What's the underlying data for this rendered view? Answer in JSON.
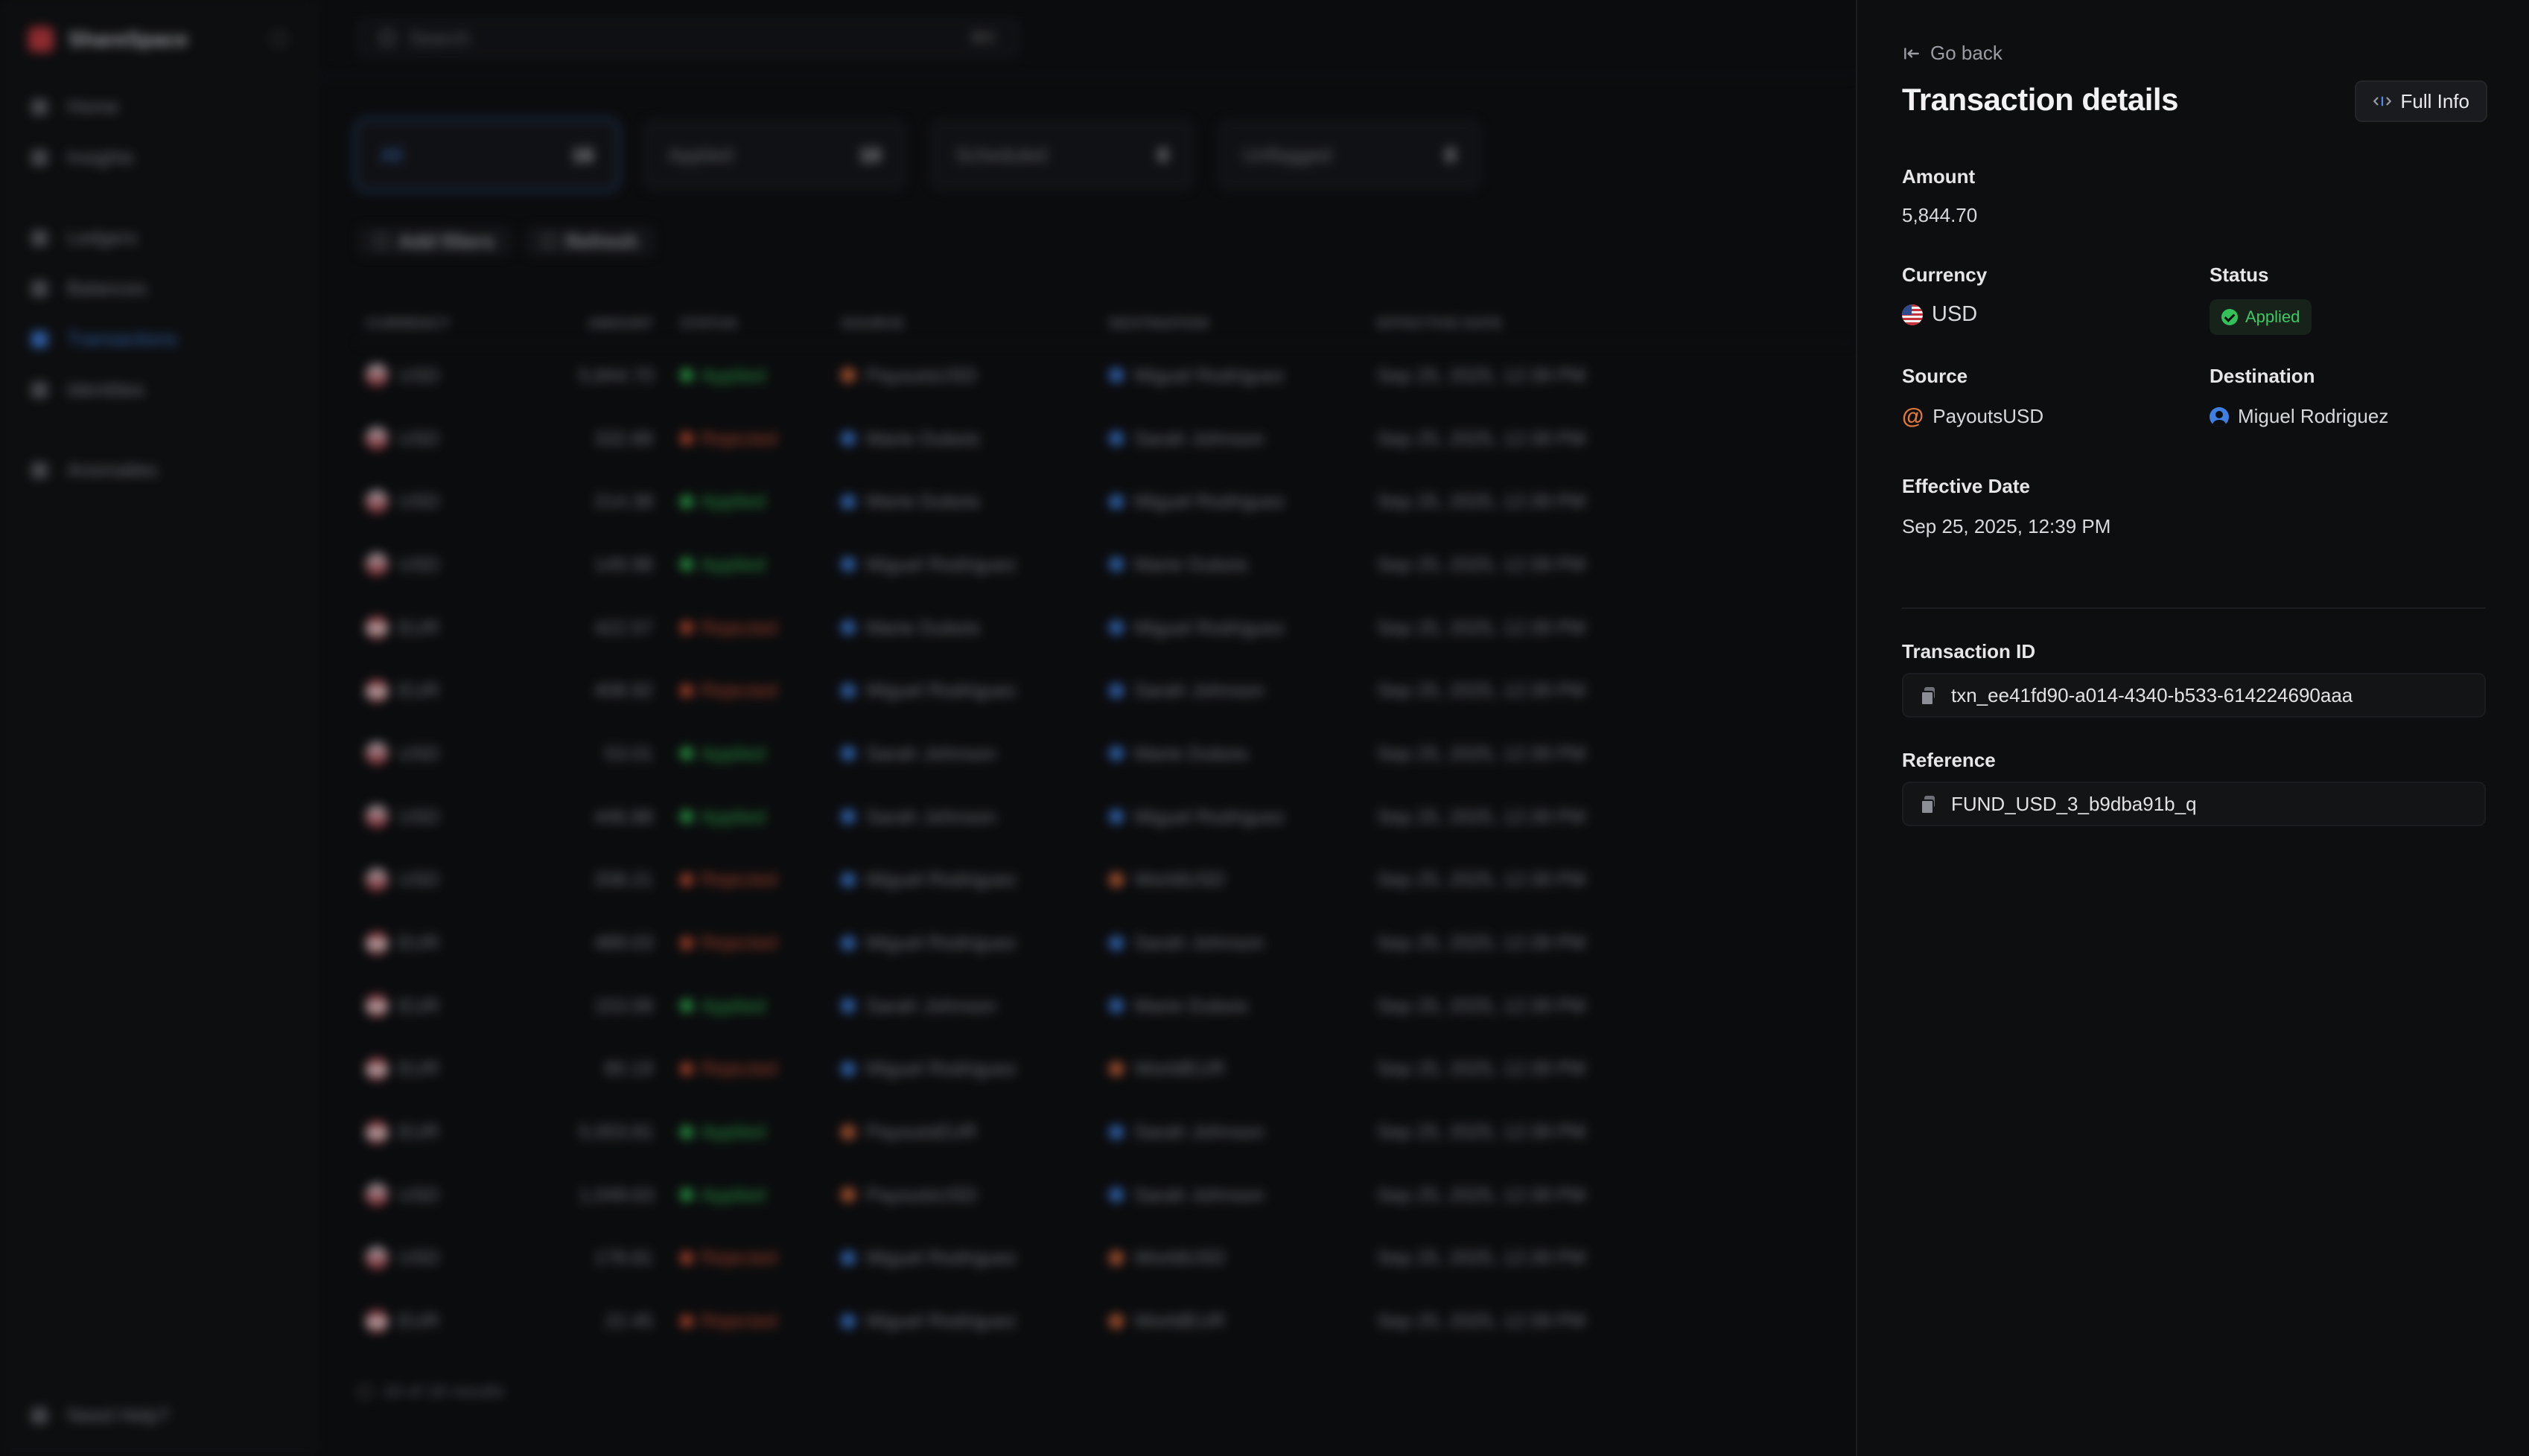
{
  "app": {
    "brand_name": "ShareSpace",
    "nav": [
      "Home",
      "Insights",
      "Ledgers",
      "Balances",
      "Transactions",
      "Identities",
      "Anomalies"
    ],
    "need_help": "Need Help?",
    "search_placeholder": "Search",
    "search_kbd": "⌘K",
    "tabs": [
      {
        "label": "All",
        "count": "16"
      },
      {
        "label": "Applied",
        "count": "10"
      },
      {
        "label": "Scheduled",
        "count": "0"
      },
      {
        "label": "Unflagged",
        "count": "0"
      }
    ],
    "filters": [
      "Add filters",
      "Refresh"
    ],
    "columns": [
      "CURRENCY",
      "AMOUNT",
      "STATUS",
      "SOURCE",
      "DESTINATION",
      "EFFECTIVE DATE"
    ],
    "rows": [
      {
        "currency": "USD",
        "amount": "5,844.70",
        "status": "Applied",
        "source": "PayoutsUSD",
        "destination": "Miguel Rodriguez",
        "date": "Sep 25, 2025, 12:39 PM"
      },
      {
        "currency": "USD",
        "amount": "332.89",
        "status": "Rejected",
        "source": "Marie Dubois",
        "destination": "Sarah Johnson",
        "date": "Sep 25, 2025, 12:39 PM"
      },
      {
        "currency": "USD",
        "amount": "214.38",
        "status": "Applied",
        "source": "Marie Dubois",
        "destination": "Miguel Rodriguez",
        "date": "Sep 25, 2025, 12:39 PM"
      },
      {
        "currency": "USD",
        "amount": "149.98",
        "status": "Applied",
        "source": "Miguel Rodriguez",
        "destination": "Marie Dubois",
        "date": "Sep 25, 2025, 12:39 PM"
      },
      {
        "currency": "EUR",
        "amount": "422.57",
        "status": "Rejected",
        "source": "Marie Dubois",
        "destination": "Miguel Rodriguez",
        "date": "Sep 25, 2025, 12:39 PM"
      },
      {
        "currency": "EUR",
        "amount": "408.92",
        "status": "Rejected",
        "source": "Miguel Rodriguez",
        "destination": "Sarah Johnson",
        "date": "Sep 25, 2025, 12:39 PM"
      },
      {
        "currency": "USD",
        "amount": "53.01",
        "status": "Applied",
        "source": "Sarah Johnson",
        "destination": "Marie Dubois",
        "date": "Sep 25, 2025, 12:39 PM"
      },
      {
        "currency": "USD",
        "amount": "446.88",
        "status": "Applied",
        "source": "Sarah Johnson",
        "destination": "Miguel Rodriguez",
        "date": "Sep 25, 2025, 12:39 PM"
      },
      {
        "currency": "USD",
        "amount": "208.21",
        "status": "Rejected",
        "source": "Miguel Rodriguez",
        "destination": "WorldUSD",
        "date": "Sep 25, 2025, 12:39 PM"
      },
      {
        "currency": "EUR",
        "amount": "489.03",
        "status": "Rejected",
        "source": "Miguel Rodriguez",
        "destination": "Sarah Johnson",
        "date": "Sep 25, 2025, 12:39 PM"
      },
      {
        "currency": "EUR",
        "amount": "153.08",
        "status": "Applied",
        "source": "Sarah Johnson",
        "destination": "Marie Dubois",
        "date": "Sep 25, 2025, 12:39 PM"
      },
      {
        "currency": "EUR",
        "amount": "80.19",
        "status": "Rejected",
        "source": "Miguel Rodriguez",
        "destination": "WorldEUR",
        "date": "Sep 25, 2025, 12:39 PM"
      },
      {
        "currency": "EUR",
        "amount": "5,003.81",
        "status": "Applied",
        "source": "PayoutsEUR",
        "destination": "Sarah Johnson",
        "date": "Sep 25, 2025, 12:39 PM"
      },
      {
        "currency": "USD",
        "amount": "1,049.63",
        "status": "Applied",
        "source": "PayoutsUSD",
        "destination": "Sarah Johnson",
        "date": "Sep 25, 2025, 12:39 PM"
      },
      {
        "currency": "USD",
        "amount": "178.81",
        "status": "Rejected",
        "source": "Miguel Rodriguez",
        "destination": "WorldUSD",
        "date": "Sep 25, 2025, 12:39 PM"
      },
      {
        "currency": "EUR",
        "amount": "22.45",
        "status": "Rejected",
        "source": "Miguel Rodriguez",
        "destination": "WorldEUR",
        "date": "Sep 25, 2025, 12:39 PM"
      }
    ],
    "footer": "16 of 16 results"
  },
  "panel": {
    "go_back": "Go back",
    "title": "Transaction details",
    "full_info": "Full Info",
    "amount_label": "Amount",
    "amount_value": "5,844.70",
    "currency_label": "Currency",
    "currency_value": "USD",
    "status_label": "Status",
    "status_value": "Applied",
    "source_label": "Source",
    "source_value": "PayoutsUSD",
    "destination_label": "Destination",
    "destination_value": "Miguel Rodriguez",
    "effective_date_label": "Effective Date",
    "effective_date_value": "Sep 25, 2025, 12:39 PM",
    "transaction_id_label": "Transaction ID",
    "transaction_id_value": "txn_ee41fd90-a014-4340-b533-614224690aaa",
    "reference_label": "Reference",
    "reference_value": "FUND_USD_3_b9dba91b_q"
  },
  "colors": {
    "accent": "#3d7fe0",
    "applied": "#33c15a",
    "rejected": "#d4502f",
    "source_icon": "#e07a3c"
  },
  "icons": {
    "go_back": "arrow-left-to-line-icon",
    "full_info": "expand-horizontal-icon",
    "copy": "copy-icon",
    "source": "at-sign-icon",
    "destination": "user-circle-icon",
    "status": "check-circle-icon",
    "currency": "us-flag-icon"
  }
}
